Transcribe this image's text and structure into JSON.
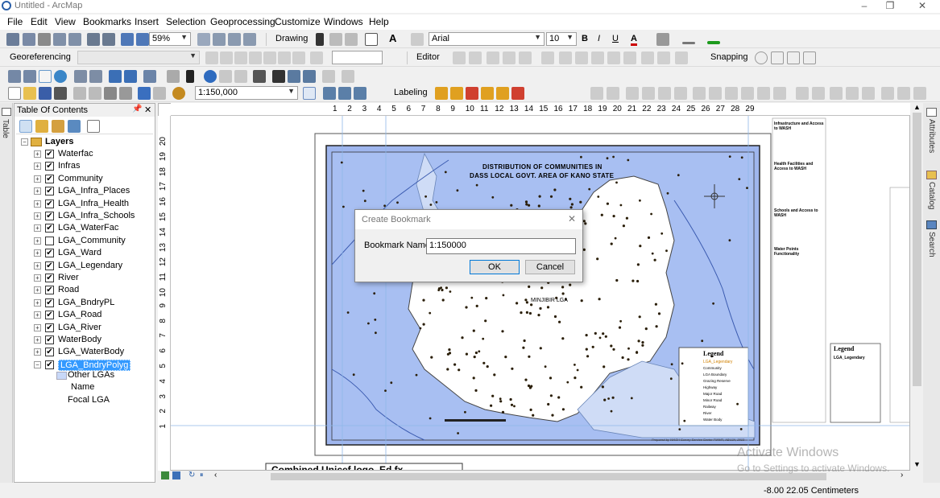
{
  "window": {
    "title": "Untitled - ArcMap",
    "controls": [
      "–",
      "❐",
      "✕"
    ]
  },
  "menu": [
    "File",
    "Edit",
    "View",
    "Bookmarks",
    "Insert",
    "Selection",
    "Geoprocessing",
    "Customize",
    "Windows",
    "Help"
  ],
  "toolbar_standard": {
    "zoom": "59%",
    "drawing_label": "Drawing",
    "font_name": "Arial",
    "font_size": "10",
    "bold": "B",
    "italic": "I",
    "underline": "U",
    "font_color_glyph": "A"
  },
  "toolbar_georef": {
    "label": "Georeferencing",
    "editor_label": "Editor",
    "snapping_label": "Snapping"
  },
  "toolbar_tools": {
    "scale": "1:150,000",
    "labeling_label": "Labeling"
  },
  "toc": {
    "title": "Table Of Contents",
    "pin": "📌",
    "close": "✕",
    "root": "Layers",
    "layers": [
      {
        "name": "Waterfac",
        "checked": true
      },
      {
        "name": "Infras",
        "checked": true
      },
      {
        "name": "Community",
        "checked": true
      },
      {
        "name": "LGA_Infra_Places",
        "checked": true
      },
      {
        "name": "LGA_Infra_Health",
        "checked": true
      },
      {
        "name": "LGA_Infra_Schools",
        "checked": true
      },
      {
        "name": "LGA_WaterFac",
        "checked": true
      },
      {
        "name": "LGA_Community",
        "checked": false
      },
      {
        "name": "LGA_Ward",
        "checked": true
      },
      {
        "name": "LGA_Legendary",
        "checked": true
      },
      {
        "name": "River",
        "checked": true
      },
      {
        "name": "Road",
        "checked": true
      },
      {
        "name": "LGA_BndryPL",
        "checked": true
      },
      {
        "name": "LGA_Road",
        "checked": true
      },
      {
        "name": "LGA_River",
        "checked": true
      },
      {
        "name": "WaterBody",
        "checked": true
      },
      {
        "name": "LGA_WaterBody",
        "checked": true
      },
      {
        "name": "LGA_BndryPolyg",
        "checked": true,
        "selected": true
      }
    ],
    "sublegend": [
      "Other LGAs",
      "Name",
      "Focal LGA"
    ]
  },
  "side_tabs_left": [
    "Table"
  ],
  "side_tabs_right": [
    "Attributes",
    "Catalog",
    "Search"
  ],
  "map": {
    "title_line1": "DISTRIBUTION OF COMMUNITIES IN",
    "title_line2": "DASS LOCAL GOVT. AREA OF KANO STATE",
    "inner_label": "MINJIBIR LGA",
    "legend_title": "Legend",
    "legend_subtitle": "LGA_Legendary",
    "legend_items": [
      "Community",
      "LGA Boundary",
      "Grazing Reserve",
      "Highway",
      "Major Road",
      "Minor Road",
      "Railway",
      "River",
      "Water Body"
    ],
    "credit": "Prepared by WASH Survey Service Sector FMWR, ABUJA, 2013",
    "ruler_h": [
      "1",
      "2",
      "3",
      "4",
      "5",
      "6",
      "7",
      "8",
      "9",
      "10",
      "11",
      "12",
      "13",
      "14",
      "15",
      "16",
      "17",
      "18",
      "19",
      "20",
      "21",
      "22",
      "23",
      "24",
      "25",
      "26",
      "27",
      "28",
      "29"
    ],
    "ruler_v": [
      "20",
      "19",
      "18",
      "17",
      "16",
      "15",
      "14",
      "13",
      "12",
      "11",
      "10",
      "9",
      "8",
      "7",
      "6",
      "5",
      "4",
      "3",
      "2",
      "1"
    ],
    "bottom_frame_text": "Combined Unicef logo_Ed.fx",
    "side_legend_head1": "Infrastructure and Access to WASH",
    "side_legend_head2": "Health Facilities and Access to WASH",
    "side_legend_head3": "Schools and Access to WASH",
    "side_legend_head4": "Water Points Functionality"
  },
  "dialog": {
    "title": "Create Bookmark",
    "close": "✕",
    "field_label": "Bookmark Name:",
    "field_value": "1:150000",
    "ok": "OK",
    "cancel": "Cancel"
  },
  "status": {
    "coords": "-8.00  22.05 Centimeters"
  },
  "watermark": {
    "line1": "Activate Windows",
    "line2": "Go to Settings to activate Windows."
  }
}
